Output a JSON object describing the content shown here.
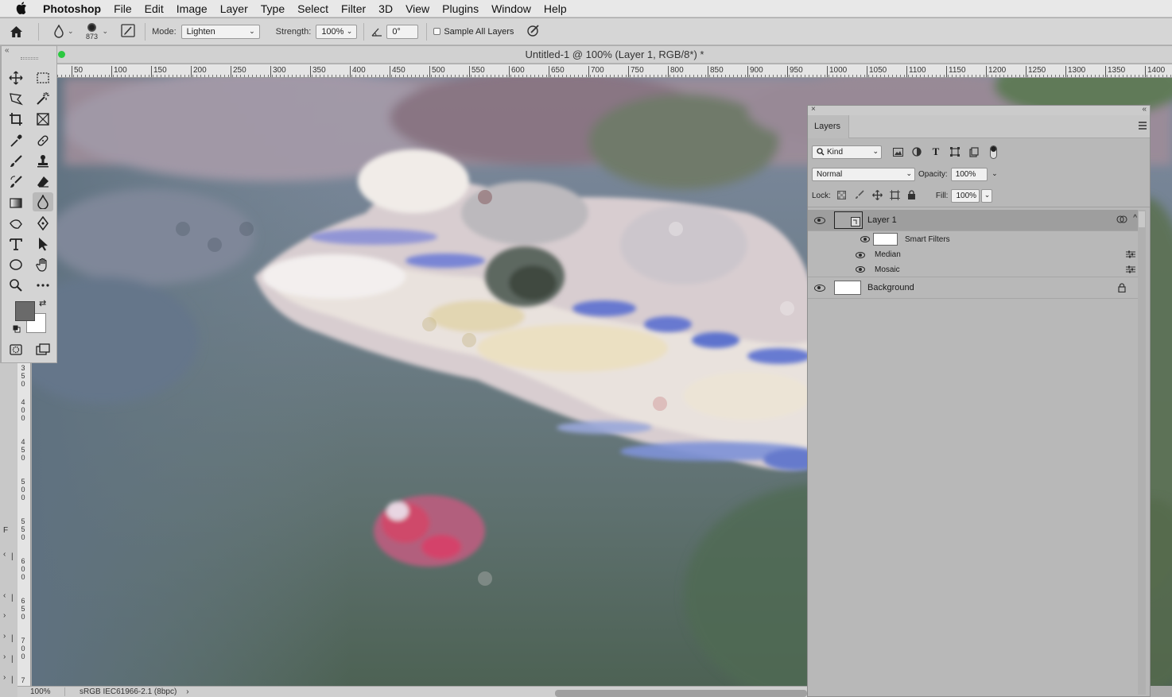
{
  "menubar": {
    "app": "Photoshop",
    "items": [
      "File",
      "Edit",
      "Image",
      "Layer",
      "Type",
      "Select",
      "Filter",
      "3D",
      "View",
      "Plugins",
      "Window",
      "Help"
    ]
  },
  "options": {
    "brush_size": "873",
    "mode_label": "Mode:",
    "mode_value": "Lighten",
    "strength_label": "Strength:",
    "strength_value": "100%",
    "angle_value": "0°",
    "sample_all_layers": "Sample All Layers"
  },
  "document": {
    "title": "Untitled-1 @ 100% (Layer 1, RGB/8*) *"
  },
  "ruler_h": [
    "50",
    "100",
    "150",
    "200",
    "250",
    "300",
    "350",
    "400",
    "450",
    "500",
    "550",
    "600",
    "650",
    "700",
    "750",
    "800",
    "850",
    "900",
    "950",
    "1000",
    "1050",
    "1100",
    "1150",
    "1200",
    "1250",
    "1300",
    "1350",
    "1400"
  ],
  "ruler_v": [
    {
      "chars": [
        "3",
        "5",
        "0"
      ]
    },
    {
      "chars": [
        "4",
        "0",
        "0"
      ]
    },
    {
      "chars": [
        "4",
        "5",
        "0"
      ]
    },
    {
      "chars": [
        "5",
        "0",
        "0"
      ]
    },
    {
      "chars": [
        "5",
        "5",
        "0"
      ]
    },
    {
      "chars": [
        "6",
        "0",
        "0"
      ]
    },
    {
      "chars": [
        "6",
        "5",
        "0"
      ]
    },
    {
      "chars": [
        "7",
        "0",
        "0"
      ]
    },
    {
      "chars": [
        "7"
      ]
    }
  ],
  "leftstrip": [
    "F",
    "‹",
    "|",
    "‹",
    "|",
    "›",
    "›",
    "|",
    "›",
    "|",
    "›",
    "|"
  ],
  "colors": {
    "foreground": "#6a6a6a",
    "background": "#ffffff",
    "active_layer": "#9e9e9e"
  },
  "layers_panel": {
    "tab": "Layers",
    "kind_label": "Kind",
    "blend_mode": "Normal",
    "opacity_label": "Opacity:",
    "opacity_value": "100%",
    "lock_label": "Lock:",
    "fill_label": "Fill:",
    "fill_value": "100%",
    "layers": [
      {
        "name": "Layer 1",
        "selected": true
      },
      {
        "name": "Smart Filters"
      },
      {
        "name": "Median"
      },
      {
        "name": "Mosaic"
      },
      {
        "name": "Background",
        "locked": true
      }
    ]
  },
  "status": {
    "zoom": "100%",
    "profile": "sRGB IEC61966-2.1 (8bpc)",
    "arrow": "›"
  }
}
